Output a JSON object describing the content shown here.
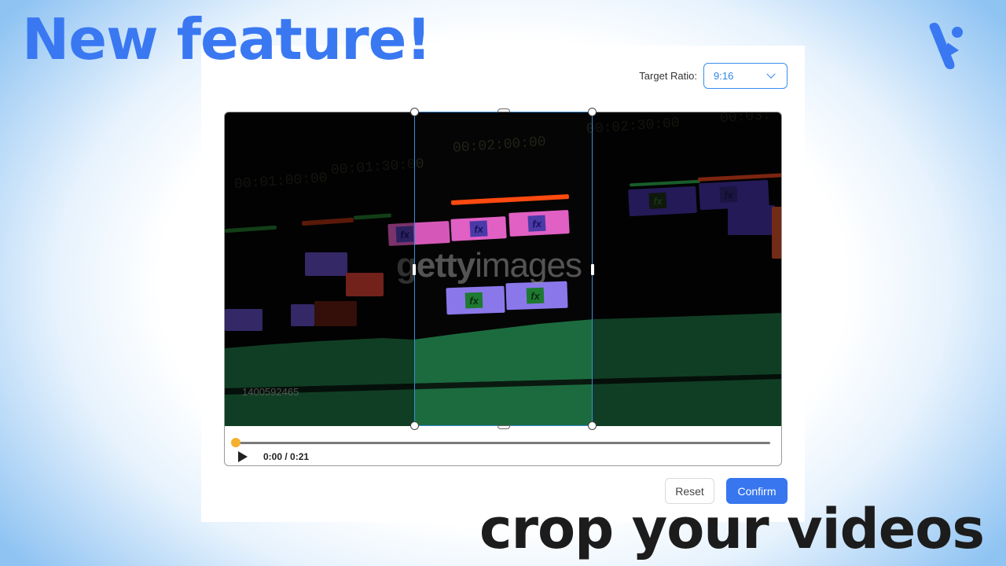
{
  "headline": "New feature!",
  "tagline": "crop your videos",
  "brand": {
    "logo_icon": "brand-v-play-logo",
    "accent_color": "#3a78f2"
  },
  "cropper": {
    "target_ratio_label": "Target Ratio:",
    "target_ratio_value": "9:16",
    "player": {
      "current_time": "0:00",
      "duration": "0:21",
      "time_display": "0:00 / 0:21",
      "progress_fraction": 0.0,
      "play_icon": "play-icon"
    },
    "video_frame": {
      "watermark": "gettyimages",
      "watermark_bold": "getty",
      "watermark_light": "images",
      "image_id": "1400592465",
      "timecodes": [
        "00:01:00:00",
        "00:01:30:00",
        "00:02:00:00",
        "00:02:30:00",
        "00:03:"
      ],
      "fx_label": "fx"
    },
    "buttons": {
      "reset": "Reset",
      "confirm": "Confirm"
    },
    "colors": {
      "crop_border": "#3a8ed8",
      "confirm_bg": "#3776ee",
      "seek_thumb": "#f4b02e",
      "select_border": "#3a8ef0"
    }
  }
}
